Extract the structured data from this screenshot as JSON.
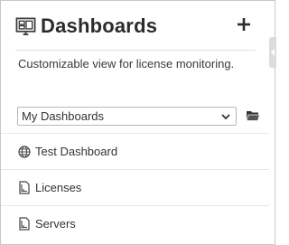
{
  "header": {
    "title": "Dashboards",
    "title_icon": "dashboard-icon",
    "add_icon": "plus-icon"
  },
  "description": "Customizable view for license monitoring.",
  "dashboard_select": {
    "selected": "My Dashboards",
    "folder_icon": "folder-open-icon"
  },
  "items": [
    {
      "label": "Test Dashboard",
      "icon": "globe-icon"
    },
    {
      "label": "Licenses",
      "icon": "document-icon"
    },
    {
      "label": "Servers",
      "icon": "document-icon"
    }
  ],
  "colors": {
    "text": "#333333",
    "border": "#c8c8c8",
    "divider": "#e8e8e8"
  }
}
